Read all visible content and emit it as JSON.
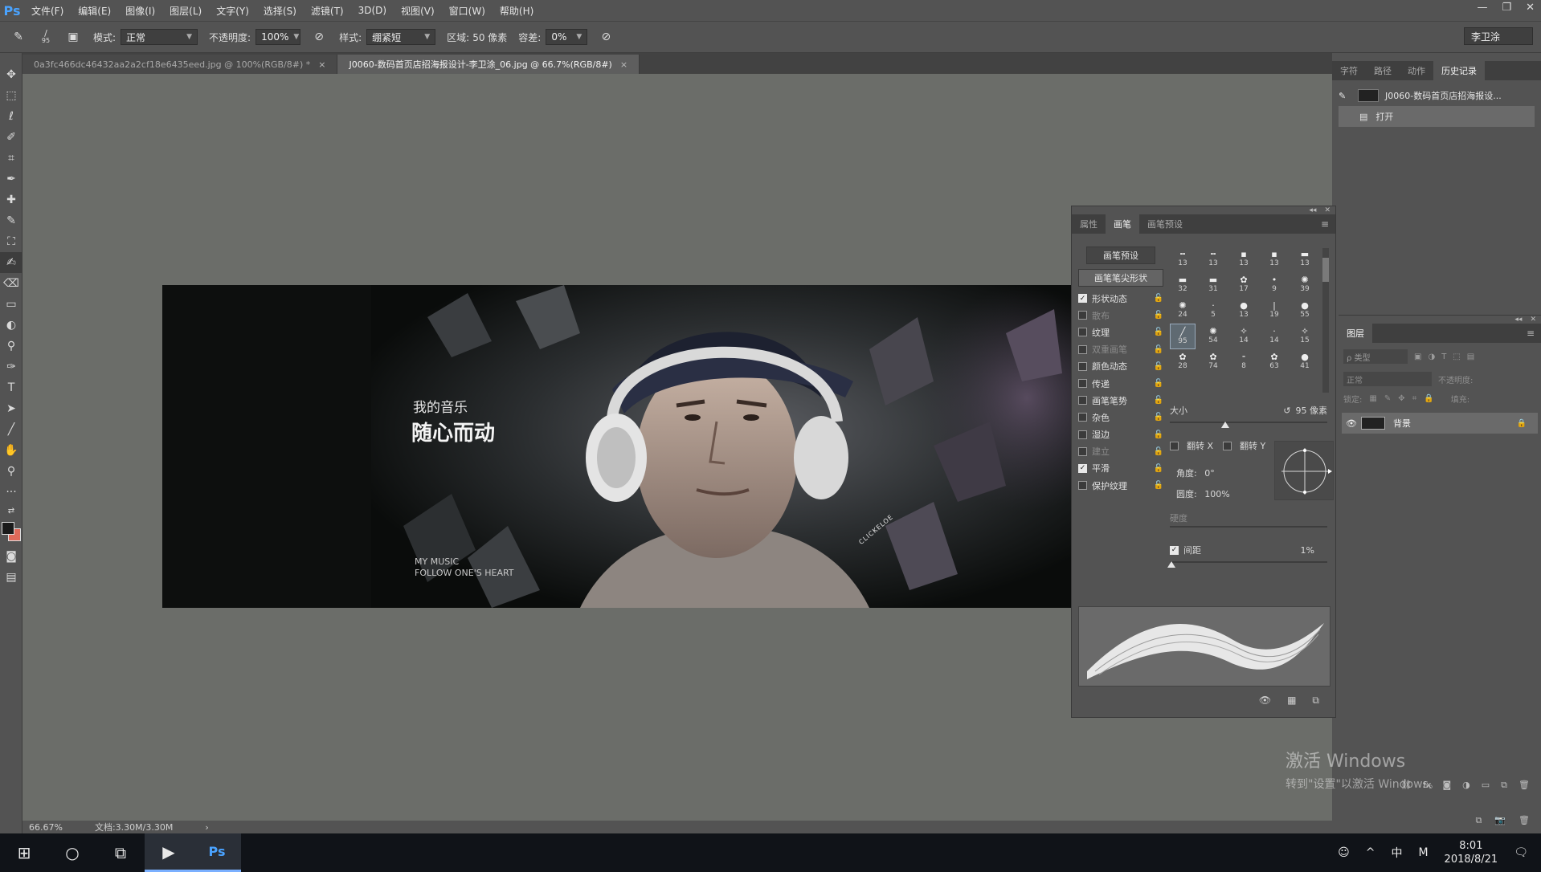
{
  "app": {
    "logo": "Ps",
    "menus": [
      "文件(F)",
      "编辑(E)",
      "图像(I)",
      "图层(L)",
      "文字(Y)",
      "选择(S)",
      "滤镜(T)",
      "3D(D)",
      "视图(V)",
      "窗口(W)",
      "帮助(H)"
    ],
    "window_controls": [
      "—",
      "❐",
      "✕"
    ]
  },
  "options": {
    "brush_size": "95",
    "mode_label": "模式:",
    "mode_value": "正常",
    "opacity_label": "不透明度:",
    "opacity_value": "100%",
    "style_label": "样式:",
    "style_value": "绷紧短",
    "area_label": "区域:",
    "area_value": "50 像素",
    "tolerance_label": "容差:",
    "tolerance_value": "0%",
    "workspace": "李卫涂"
  },
  "tabs": [
    {
      "label": "0a3fc466dc46432aa2a2cf18e6435eed.jpg @ 100%(RGB/8#) *",
      "close": "×"
    },
    {
      "label": "J0060-数码首页店招海报设计-李卫涂_06.jpg @ 66.7%(RGB/8#)",
      "close": "×"
    }
  ],
  "document": {
    "line1": "我的音乐",
    "line2": "随心而动",
    "en1": "MY MUSIC",
    "en2": "FOLLOW ONE'S HEART",
    "side_text": "CLICKELOE"
  },
  "status": {
    "zoom": "66.67%",
    "doc_info": "文档:3.30M/3.30M",
    "arrow": "›"
  },
  "history_panel": {
    "tabs": [
      "字符",
      "路径",
      "动作",
      "历史记录"
    ],
    "items": [
      "J0060-数码首页店招海报设...",
      "打开"
    ]
  },
  "brush_panel": {
    "tabs": [
      "属性",
      "画笔",
      "画笔预设"
    ],
    "preset_button": "画笔预设",
    "tip_shape_button": "画笔笔尖形状",
    "options": [
      {
        "label": "形状动态",
        "checked": true,
        "disabled": false
      },
      {
        "label": "散布",
        "checked": false,
        "disabled": true
      },
      {
        "label": "纹理",
        "checked": false,
        "disabled": false
      },
      {
        "label": "双重画笔",
        "checked": false,
        "disabled": true
      },
      {
        "label": "颜色动态",
        "checked": false,
        "disabled": false
      },
      {
        "label": "传递",
        "checked": false,
        "disabled": false
      },
      {
        "label": "画笔笔势",
        "checked": false,
        "disabled": false
      },
      {
        "label": "杂色",
        "checked": false,
        "disabled": false
      },
      {
        "label": "湿边",
        "checked": false,
        "disabled": false
      },
      {
        "label": "建立",
        "checked": false,
        "disabled": true
      },
      {
        "label": "平滑",
        "checked": true,
        "disabled": false
      },
      {
        "label": "保护纹理",
        "checked": false,
        "disabled": false
      }
    ],
    "tip_sizes": [
      "13",
      "13",
      "13",
      "13",
      "13",
      "32",
      "31",
      "17",
      "9",
      "39",
      "24",
      "5",
      "13",
      "19",
      "55",
      "95",
      "54",
      "14",
      "14",
      "15",
      "28",
      "74",
      "8",
      "63",
      "41"
    ],
    "size_label": "大小",
    "size_value": "95 像素",
    "size_fraction": 0.35,
    "flip_x": "翻转 X",
    "flip_y": "翻转 Y",
    "angle_label": "角度:",
    "angle_value": "0°",
    "roundness_label": "圆度:",
    "roundness_value": "100%",
    "hardness_label": "硬度",
    "spacing_label": "间距",
    "spacing_value": "1%",
    "spacing_fraction": 0.01
  },
  "layers_panel": {
    "title": "图层",
    "search": "ρ 类型",
    "blend": "正常",
    "opacity_label": "不透明度:",
    "lock_label": "锁定:",
    "fill_label": "填充:",
    "layer_name": "背景"
  },
  "watermark": {
    "line1": "激活 Windows",
    "line2": "转到\"设置\"以激活 Windows。"
  },
  "taskbar": {
    "ime": "中",
    "time": "8:01",
    "date": "2018/8/21"
  },
  "colors": {
    "accent": "#4aa3ff",
    "foreground_swatch": "#1a1a1a",
    "background_swatch": "#e06a5a"
  }
}
